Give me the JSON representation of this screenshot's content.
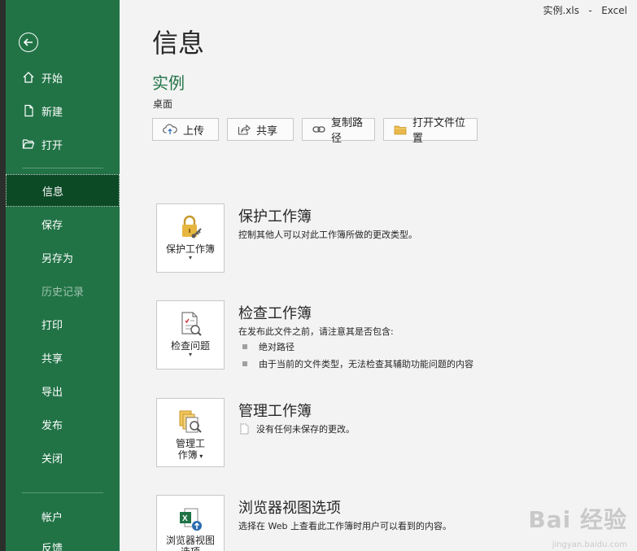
{
  "titlebar": {
    "filename": "实例.xls",
    "separator": "-",
    "app": "Excel"
  },
  "sidebar": {
    "back_icon": "back-arrow-icon",
    "top_items": [
      {
        "label": "开始",
        "icon": "home-icon"
      },
      {
        "label": "新建",
        "icon": "new-document-icon"
      },
      {
        "label": "打开",
        "icon": "open-folder-icon"
      }
    ],
    "items": [
      {
        "label": "信息",
        "state": "active"
      },
      {
        "label": "保存",
        "state": "normal"
      },
      {
        "label": "另存为",
        "state": "normal"
      },
      {
        "label": "历史记录",
        "state": "disabled"
      },
      {
        "label": "打印",
        "state": "normal"
      },
      {
        "label": "共享",
        "state": "normal"
      },
      {
        "label": "导出",
        "state": "normal"
      },
      {
        "label": "发布",
        "state": "normal"
      },
      {
        "label": "关闭",
        "state": "normal"
      }
    ],
    "bottom_items": [
      {
        "label": "帐户"
      },
      {
        "label": "反馈"
      }
    ],
    "colors": {
      "background": "#217346",
      "active": "#0c4a26"
    }
  },
  "main": {
    "title": "信息",
    "doc_name": "实例",
    "doc_location": "桌面",
    "actions": [
      {
        "label": "上传",
        "icon": "upload-cloud-icon"
      },
      {
        "label": "共享",
        "icon": "share-icon"
      },
      {
        "label": "复制路径",
        "icon": "link-icon"
      },
      {
        "label": "打开文件位置",
        "icon": "folder-icon"
      }
    ],
    "sections": [
      {
        "card_label": "保护工作簿",
        "card_icon": "lock-key-icon",
        "title": "保护工作簿",
        "desc": "控制其他人可以对此工作簿所做的更改类型。",
        "bullets": []
      },
      {
        "card_label": "检查问题",
        "card_icon": "inspect-document-icon",
        "title": "检查工作簿",
        "desc": "在发布此文件之前，请注意其是否包含:",
        "bullets": [
          "绝对路径",
          "由于当前的文件类型，无法检查其辅助功能问题的内容"
        ]
      },
      {
        "card_label_line1": "管理工",
        "card_label_line2": "作簿",
        "card_icon": "manage-workbook-icon",
        "title": "管理工作簿",
        "desc": "没有任何未保存的更改。",
        "bullets": []
      },
      {
        "card_label_line1": "浏览器视图",
        "card_label_line2": "选项",
        "card_icon": "excel-browser-view-icon",
        "title": "浏览器视图选项",
        "desc": "选择在 Web 上查看此工作簿时用户可以看到的内容。",
        "bullets": []
      }
    ]
  },
  "watermark": {
    "text": "Bai 经验",
    "sub": "jingyan.baidu.com"
  }
}
